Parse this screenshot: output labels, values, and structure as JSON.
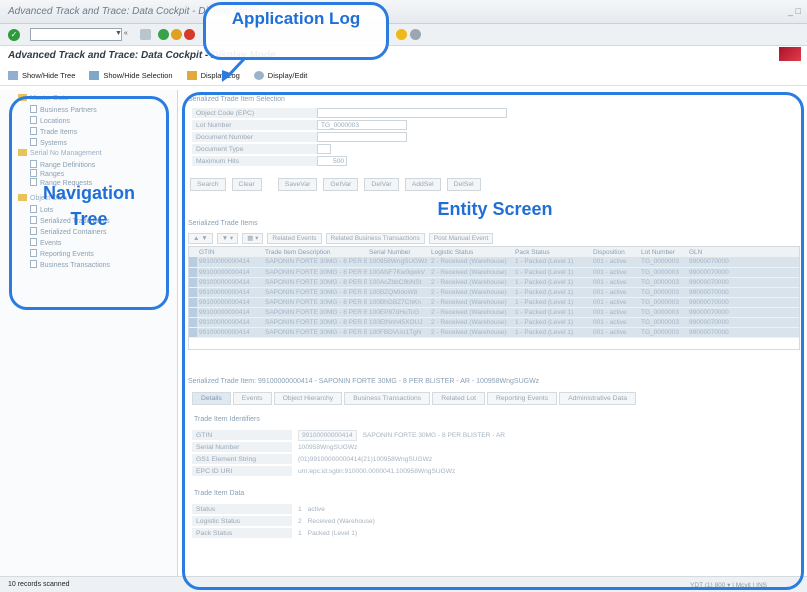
{
  "window": {
    "title": "Advanced Track and Trace: Data Cockpit - Display Mode",
    "controls": "_ □"
  },
  "app": {
    "title": "Advanced Track and Trace: Data Cockpit - Display Mode",
    "toolbar": [
      {
        "label": "Show/Hide Tree",
        "icon": "tree-icon"
      },
      {
        "label": "Show/Hide Selection",
        "icon": "selection-icon"
      },
      {
        "label": "Display Log",
        "icon": "log-icon"
      },
      {
        "label": "Display/Edit",
        "icon": "edit-icon"
      }
    ]
  },
  "tree": {
    "items": [
      {
        "label": "Master Data",
        "folder": true
      },
      {
        "label": "Business Partners"
      },
      {
        "label": "Locations"
      },
      {
        "label": "Trade Items"
      },
      {
        "label": "Systems"
      },
      {
        "label": "Serial No Management",
        "folder": true
      },
      {
        "label": "Range Definitions"
      },
      {
        "label": "Ranges"
      },
      {
        "label": "Range Requests"
      },
      {
        "label": "Object Data",
        "folder": true
      },
      {
        "label": "Lots"
      },
      {
        "label": "Serialized Trade Items"
      },
      {
        "label": "Serialized Containers"
      },
      {
        "label": "Events"
      },
      {
        "label": "Reporting Events"
      },
      {
        "label": "Business Transactions"
      }
    ]
  },
  "selection": {
    "title": "Serialized Trade Item Selection",
    "fields": [
      {
        "label": "Object Code (EPC)",
        "value": ""
      },
      {
        "label": "Lot Number",
        "value": "TG_0000003"
      },
      {
        "label": "Document Number",
        "value": ""
      },
      {
        "label": "Document Type",
        "value": ""
      },
      {
        "label": "Maximum Hits",
        "value": "500"
      }
    ],
    "buttons": [
      "Search",
      "Clear",
      "SaveVar",
      "GetVar",
      "DelVar",
      "AddSel",
      "DelSel"
    ]
  },
  "grid": {
    "title": "Serialized Trade Items",
    "toolbar": [
      "Related Events",
      "Related Business Transactions",
      "Post Manual Event"
    ],
    "columns": [
      "GTIN",
      "Trade Item Description",
      "Serial Number",
      "Logistic Status",
      "Pack Status",
      "Disposition",
      "Lot Number",
      "GLN"
    ],
    "rows": [
      [
        "99100000000414",
        "SAPONIN FORTE 30MG - 8 PER BLISTER - AR",
        "100958WngSUGWz",
        "2 - Received (Warehouse)",
        "1 - Packed (Level 1)",
        "001 - active",
        "TG_0000003",
        "99000070000"
      ],
      [
        "99100000000414",
        "SAPONIN FORTE 30MG - 8 PER BLISTER - AR",
        "100ANF7Kw0qwkV",
        "2 - Received (Warehouse)",
        "1 - Packed (Level 1)",
        "001 - active",
        "TG_0000003",
        "99000070000"
      ],
      [
        "99100000000414",
        "SAPONIN FORTE 30MG - 8 PER BLISTER - AR",
        "100AcZbbC8bNSt",
        "2 - Received (Warehouse)",
        "1 - Packed (Level 1)",
        "001 - active",
        "TG_0000003",
        "99000070000"
      ],
      [
        "99100000000414",
        "SAPONIN FORTE 30MG - 8 PER BLISTER - AR",
        "100BZQMIdoW8",
        "2 - Received (Warehouse)",
        "1 - Packed (Level 1)",
        "001 - active",
        "TG_0000003",
        "99000070000"
      ],
      [
        "99100000000414",
        "SAPONIN FORTE 30MG - 8 PER BLISTER - AR",
        "100BhGBZ7ChKn",
        "2 - Received (Warehouse)",
        "1 - Packed (Level 1)",
        "001 - active",
        "TG_0000003",
        "99000070000"
      ],
      [
        "99100000000414",
        "SAPONIN FORTE 30MG - 8 PER BLISTER - AR",
        "100EP87dHuTcG",
        "2 - Received (Warehouse)",
        "1 - Packed (Level 1)",
        "001 - active",
        "TG_0000003",
        "99000070000"
      ],
      [
        "99100000000414",
        "SAPONIN FORTE 30MG - 8 PER BLISTER - AR",
        "100EtNnh45XOUJ",
        "2 - Received (Warehouse)",
        "1 - Packed (Level 1)",
        "001 - active",
        "TG_0000003",
        "99000070000"
      ],
      [
        "99100000000414",
        "SAPONIN FORTE 30MG - 8 PER BLISTER - AR",
        "100FBDVUo1TgN",
        "2 - Received (Warehouse)",
        "1 - Packed (Level 1)",
        "001 - active",
        "TG_0000003",
        "99000070000"
      ]
    ]
  },
  "detail": {
    "title": "Serialized Trade Item: 99100000000414 - SAPONIN FORTE 30MG - 8 PER BLISTER - AR - 100958WngSUGWz",
    "tabs": [
      "Details",
      "Events",
      "Object Hierarchy",
      "Business Transactions",
      "Related Lot",
      "Reporting Events",
      "Administrative Data"
    ],
    "identifiers_title": "Trade Item Identifiers",
    "identifiers": [
      {
        "label": "GTIN",
        "code": "99100000000414",
        "value": "SAPONIN FORTE 30MG - 8 PER BLISTER - AR"
      },
      {
        "label": "Serial Number",
        "code": "",
        "value": "100958WngSUGWz"
      },
      {
        "label": "GS1 Element String",
        "code": "",
        "value": "(01)99100000000414(21)100958WngSUGWz"
      },
      {
        "label": "EPC ID URI",
        "code": "",
        "value": "urn:epc:id:sgtin:910000.0000041.100958WngSUGWz"
      }
    ],
    "data_title": "Trade Item Data",
    "data": [
      {
        "label": "Status",
        "code": "1",
        "value": "active"
      },
      {
        "label": "Logistic Status",
        "code": "2",
        "value": "Received (Warehouse)"
      },
      {
        "label": "Pack Status",
        "code": "1",
        "value": "Packed (Level 1)"
      }
    ]
  },
  "status": {
    "text": "10 records scanned",
    "sysinfo": "YDT (1) 800 ▾ | Mcvit | INS"
  },
  "callouts": {
    "application_log": "Application Log",
    "navigation_tree": "Navigation Tree",
    "entity_screen": "Entity Screen"
  },
  "colors": {
    "callout": "#2a7ce0",
    "callout_text": "#1f6fd6"
  }
}
